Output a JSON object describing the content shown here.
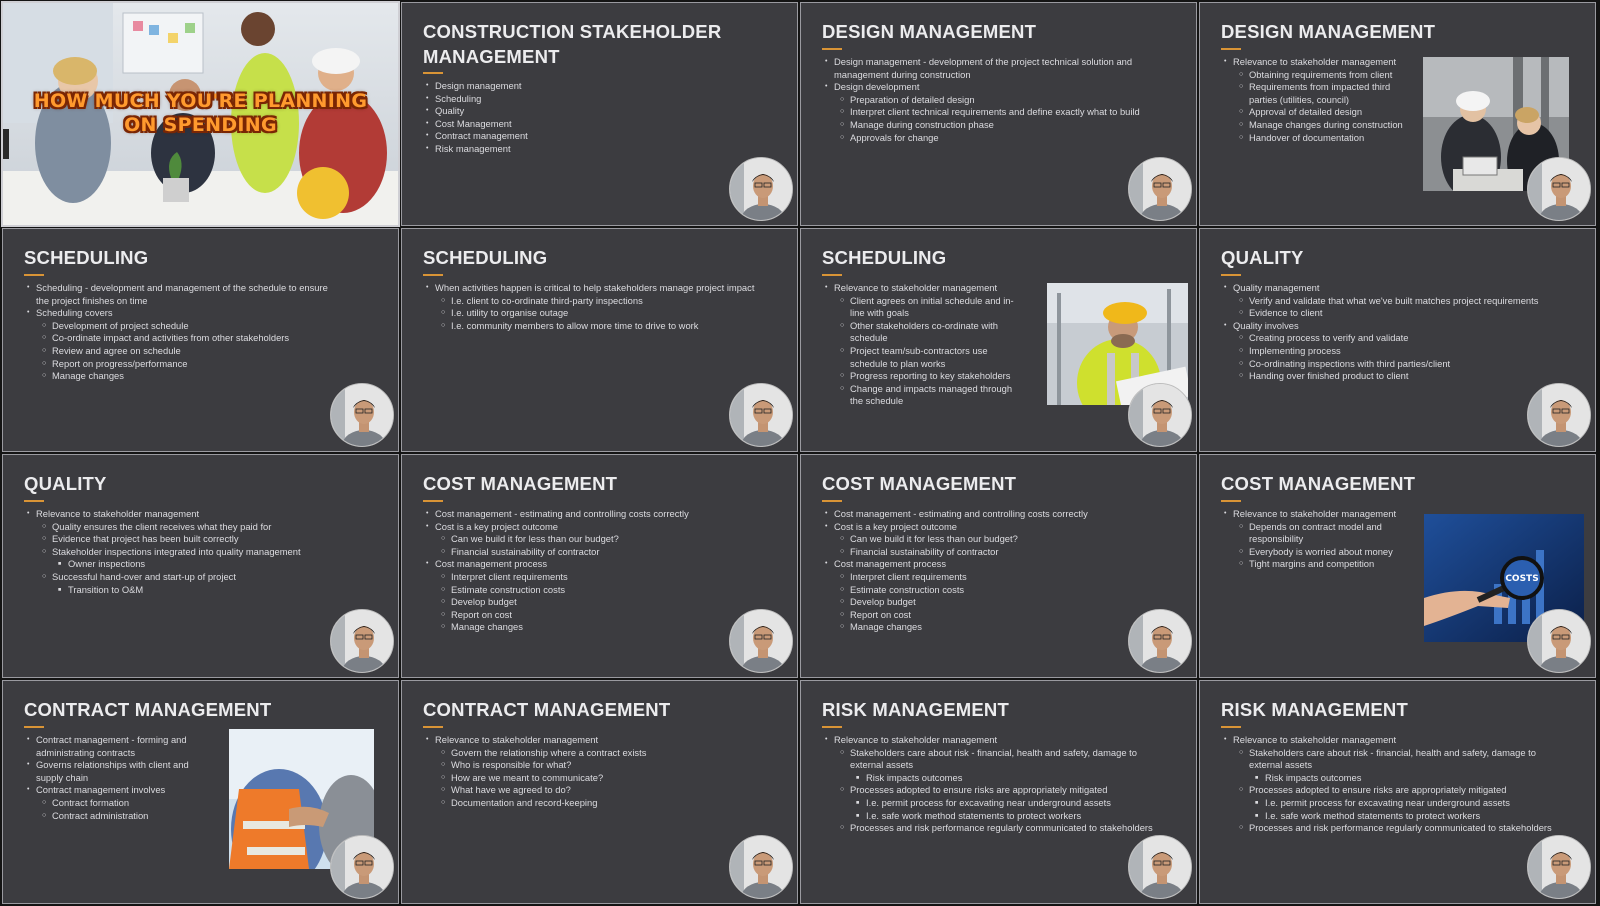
{
  "slides": [
    {
      "type": "thumbnail",
      "caption": "HOW MUCH YOU'RE PLANNING\nON SPENDING"
    },
    {
      "title": "CONSTRUCTION STAKEHOLDER\nMANAGEMENT",
      "bullets": [
        {
          "level": 1,
          "text": "Design management"
        },
        {
          "level": 1,
          "text": "Scheduling"
        },
        {
          "level": 1,
          "text": "Quality"
        },
        {
          "level": 1,
          "text": "Cost Management"
        },
        {
          "level": 1,
          "text": "Contract management"
        },
        {
          "level": 1,
          "text": "Risk management"
        }
      ]
    },
    {
      "title": "DESIGN MANAGEMENT",
      "bullets": [
        {
          "level": 1,
          "text": "Design management - development of the project technical solution and management during construction"
        },
        {
          "level": 1,
          "text": "Design development"
        },
        {
          "level": 2,
          "text": "Preparation of detailed design"
        },
        {
          "level": 2,
          "text": "Interpret client technical requirements and define exactly what to build"
        },
        {
          "level": 2,
          "text": "Manage during construction phase"
        },
        {
          "level": 2,
          "text": "Approvals for change"
        }
      ]
    },
    {
      "title": "DESIGN MANAGEMENT",
      "image": "engineers-reviewing-plans",
      "bullets": [
        {
          "level": 1,
          "text": "Relevance to stakeholder management"
        },
        {
          "level": 2,
          "text": "Obtaining requirements from client"
        },
        {
          "level": 2,
          "text": "Requirements from impacted third parties (utilities, council)"
        },
        {
          "level": 2,
          "text": "Approval of detailed design"
        },
        {
          "level": 2,
          "text": "Manage changes during construction"
        },
        {
          "level": 2,
          "text": "Handover of documentation"
        }
      ]
    },
    {
      "title": "SCHEDULING",
      "bullets": [
        {
          "level": 1,
          "text": "Scheduling - development and management of the schedule to ensure the project finishes on time"
        },
        {
          "level": 1,
          "text": "Scheduling covers"
        },
        {
          "level": 2,
          "text": "Development of project schedule"
        },
        {
          "level": 2,
          "text": "Co-ordinate impact and activities from other stakeholders"
        },
        {
          "level": 2,
          "text": "Review and agree on schedule"
        },
        {
          "level": 2,
          "text": "Report on progress/performance"
        },
        {
          "level": 2,
          "text": "Manage changes"
        }
      ]
    },
    {
      "title": "SCHEDULING",
      "bullets": [
        {
          "level": 1,
          "text": "When activities happen is critical to help stakeholders manage project impact"
        },
        {
          "level": 2,
          "text": "I.e. client to co-ordinate third-party inspections"
        },
        {
          "level": 2,
          "text": "I.e. utility to organise outage"
        },
        {
          "level": 2,
          "text": "I.e. community members to allow more time to drive to work"
        }
      ]
    },
    {
      "title": "SCHEDULING",
      "image": "worker-in-hard-hat",
      "bullets": [
        {
          "level": 1,
          "text": "Relevance to stakeholder management"
        },
        {
          "level": 2,
          "text": "Client agrees on initial schedule and in-line with goals"
        },
        {
          "level": 2,
          "text": "Other stakeholders co-ordinate with schedule"
        },
        {
          "level": 2,
          "text": "Project team/sub-contractors use schedule to plan works"
        },
        {
          "level": 2,
          "text": "Progress reporting to key stakeholders"
        },
        {
          "level": 2,
          "text": "Change and impacts managed through the schedule"
        }
      ]
    },
    {
      "title": "QUALITY",
      "bullets": [
        {
          "level": 1,
          "text": "Quality management"
        },
        {
          "level": 2,
          "text": "Verify and validate that what we've built matches project requirements"
        },
        {
          "level": 2,
          "text": "Evidence to client"
        },
        {
          "level": 1,
          "text": "Quality involves"
        },
        {
          "level": 2,
          "text": "Creating process to verify and validate"
        },
        {
          "level": 2,
          "text": "Implementing process"
        },
        {
          "level": 2,
          "text": "Co-ordinating inspections with third parties/client"
        },
        {
          "level": 2,
          "text": "Handing over finished product to client"
        }
      ]
    },
    {
      "title": "QUALITY",
      "bullets": [
        {
          "level": 1,
          "text": "Relevance to stakeholder management"
        },
        {
          "level": 2,
          "text": "Quality ensures the client receives what they paid for"
        },
        {
          "level": 2,
          "text": "Evidence that project has been built correctly"
        },
        {
          "level": 2,
          "text": "Stakeholder inspections integrated into quality management"
        },
        {
          "level": 3,
          "text": "Owner inspections"
        },
        {
          "level": 2,
          "text": "Successful hand-over and start-up of project"
        },
        {
          "level": 3,
          "text": "Transition to O&M"
        }
      ]
    },
    {
      "title": "COST MANAGEMENT",
      "bullets": [
        {
          "level": 1,
          "text": "Cost management - estimating and controlling costs correctly"
        },
        {
          "level": 1,
          "text": "Cost is a key project outcome"
        },
        {
          "level": 2,
          "text": "Can we build it for less than our budget?"
        },
        {
          "level": 2,
          "text": "Financial sustainability of contractor"
        },
        {
          "level": 1,
          "text": "Cost management process"
        },
        {
          "level": 2,
          "text": "Interpret client requirements"
        },
        {
          "level": 2,
          "text": "Estimate construction costs"
        },
        {
          "level": 2,
          "text": "Develop budget"
        },
        {
          "level": 2,
          "text": "Report on cost"
        },
        {
          "level": 2,
          "text": "Manage changes"
        }
      ]
    },
    {
      "title": "COST MANAGEMENT",
      "bullets": [
        {
          "level": 1,
          "text": "Cost management - estimating and controlling costs correctly"
        },
        {
          "level": 1,
          "text": "Cost is a key project outcome"
        },
        {
          "level": 2,
          "text": "Can we build it for less than our budget?"
        },
        {
          "level": 2,
          "text": "Financial sustainability of contractor"
        },
        {
          "level": 1,
          "text": "Cost management process"
        },
        {
          "level": 2,
          "text": "Interpret client requirements"
        },
        {
          "level": 2,
          "text": "Estimate construction costs"
        },
        {
          "level": 2,
          "text": "Develop budget"
        },
        {
          "level": 2,
          "text": "Report on cost"
        },
        {
          "level": 2,
          "text": "Manage changes"
        }
      ]
    },
    {
      "title": "COST MANAGEMENT",
      "image": "magnifier-costs",
      "image_text": "COSTS",
      "bullets": [
        {
          "level": 1,
          "text": "Relevance to stakeholder management"
        },
        {
          "level": 2,
          "text": "Depends on contract model and responsibility"
        },
        {
          "level": 2,
          "text": "Everybody is worried about money"
        },
        {
          "level": 2,
          "text": "Tight margins and competition"
        }
      ]
    },
    {
      "title": "CONTRACT MANAGEMENT",
      "image": "handshake-workers",
      "bullets": [
        {
          "level": 1,
          "text": "Contract management - forming and administrating contracts"
        },
        {
          "level": 1,
          "text": "Governs relationships with client and supply chain"
        },
        {
          "level": 1,
          "text": "Contract management involves"
        },
        {
          "level": 2,
          "text": "Contract formation"
        },
        {
          "level": 2,
          "text": "Contract administration"
        }
      ]
    },
    {
      "title": "CONTRACT MANAGEMENT",
      "bullets": [
        {
          "level": 1,
          "text": "Relevance to stakeholder management"
        },
        {
          "level": 2,
          "text": "Govern the relationship where a contract exists"
        },
        {
          "level": 2,
          "text": "Who is responsible for what?"
        },
        {
          "level": 2,
          "text": "How are we meant to communicate?"
        },
        {
          "level": 2,
          "text": "What have we agreed to do?"
        },
        {
          "level": 2,
          "text": "Documentation and record-keeping"
        }
      ]
    },
    {
      "title": "RISK MANAGEMENT",
      "bullets": [
        {
          "level": 1,
          "text": "Relevance to stakeholder management"
        },
        {
          "level": 2,
          "text": "Stakeholders care about risk - financial, health and safety, damage to external assets"
        },
        {
          "level": 3,
          "text": "Risk impacts outcomes"
        },
        {
          "level": 2,
          "text": "Processes adopted to ensure risks are appropriately mitigated"
        },
        {
          "level": 3,
          "text": "I.e. permit process for excavating near underground assets"
        },
        {
          "level": 3,
          "text": "I.e. safe work method statements to protect workers"
        },
        {
          "level": 2,
          "text": "Processes and risk performance regularly communicated to stakeholders"
        }
      ]
    },
    {
      "title": "RISK MANAGEMENT",
      "bullets": [
        {
          "level": 1,
          "text": "Relevance to stakeholder management"
        },
        {
          "level": 2,
          "text": "Stakeholders care about risk - financial, health and safety, damage to external assets"
        },
        {
          "level": 3,
          "text": "Risk impacts outcomes"
        },
        {
          "level": 2,
          "text": "Processes adopted to ensure risks are appropriately mitigated"
        },
        {
          "level": 3,
          "text": "I.e. permit process for excavating near underground assets"
        },
        {
          "level": 3,
          "text": "I.e. safe work method statements to protect workers"
        },
        {
          "level": 2,
          "text": "Processes and risk performance regularly communicated to stakeholders"
        }
      ]
    }
  ],
  "colors": {
    "slide_bg": "#3c3c40",
    "title": "#ececee",
    "body_text": "#dcdce0",
    "accent_rule": "#d99436",
    "thumbnail_caption": "#ff9a2e"
  }
}
